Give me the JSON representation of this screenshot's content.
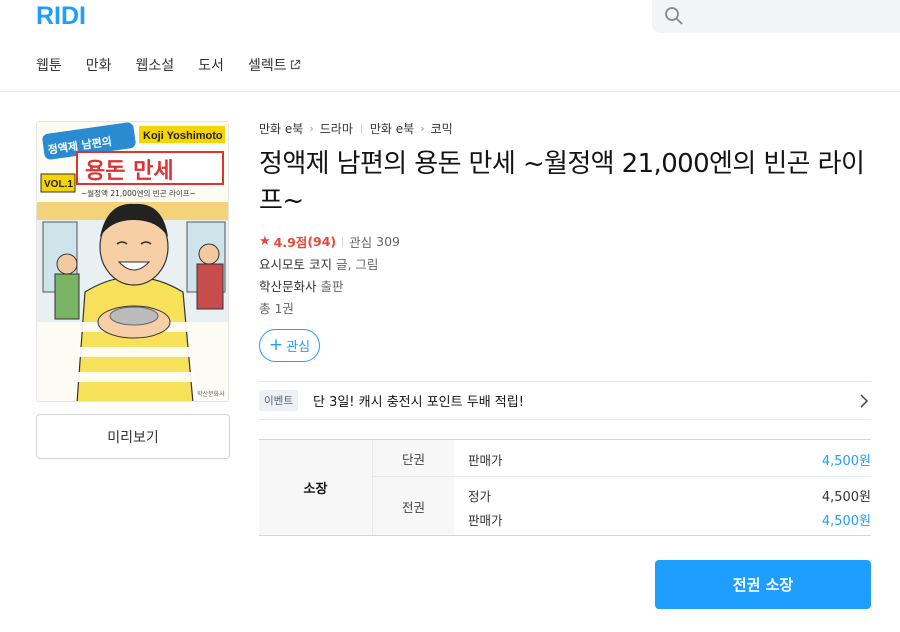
{
  "header": {
    "logo": "RIDI",
    "search_placeholder": "",
    "nav": [
      "웹툰",
      "만화",
      "웹소설",
      "도서",
      "셀렉트"
    ]
  },
  "book": {
    "breadcrumbs": [
      [
        "만화 e북",
        "드라마"
      ],
      [
        "만화 e북",
        "코믹"
      ]
    ],
    "title": "정액제 남편의 용돈 만세 ~월정액 21,000엔의 빈곤 라이프~",
    "rating": {
      "score": "4.9점",
      "count": "(94)",
      "interest_label": "관심",
      "interest_count": "309"
    },
    "author_name": "요시모토 코지",
    "author_role": "글, 그림",
    "publisher_name": "학산문화사",
    "publisher_role": "출판",
    "volumes": "총 1권",
    "cover": {
      "title_top": "정액제 남편의",
      "title_main": "용돈 만세",
      "author_en": "Koji Yoshimoto",
      "subtitle": "~월정액 21,000엔의 빈곤 라이프~",
      "vol": "VOL.1",
      "publisher": "학산문화사"
    }
  },
  "buttons": {
    "preview": "미리보기",
    "wishlist": "관심",
    "buy_all": "전권 소장"
  },
  "event": {
    "badge": "이벤트",
    "text": "단 3일! 캐시 충전시 포인트 두배 적립!"
  },
  "price": {
    "own_label": "소장",
    "single": {
      "type": "단권",
      "sale_label": "판매가",
      "sale_value": "4,500원"
    },
    "set": {
      "type": "전권",
      "list_label": "정가",
      "list_value": "4,500원",
      "sale_label": "판매가",
      "sale_value": "4,500원"
    }
  },
  "colors": {
    "accent": "#1e9eff",
    "rating": "#e64938"
  }
}
